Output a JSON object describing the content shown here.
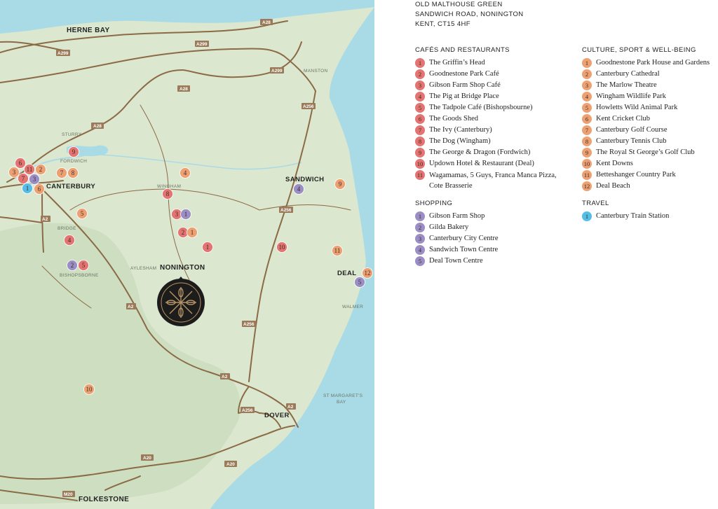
{
  "address": [
    "OLD MALTHOUSE GREEN",
    "SANDWICH ROAD, NONINGTON",
    "KENT, CT15 4HF"
  ],
  "colors": {
    "land": "#dbe7cf",
    "sea": "#a9dbe6",
    "road": "#8b6a46",
    "cafes": "#e37471",
    "culture": "#eda172",
    "shopping": "#9a8ec4",
    "travel": "#55bde6",
    "logo_bg": "#1c1c1c",
    "logo_fg": "#b59363"
  },
  "map": {
    "places": {
      "herne_bay": "HERNE BAY",
      "canterbury": "CANTERBURY",
      "sandwich": "SANDWICH",
      "nonington": "NONINGTON",
      "deal": "DEAL",
      "dover": "DOVER",
      "folkestone": "FOLKESTONE"
    },
    "small_places": {
      "sturry": "STURRY",
      "fordwich": "FORDWICH",
      "wingham": "WINGHAM",
      "manston": "MANSTON",
      "bridge": "BRIDGE",
      "bishopsborne": "BISHOPSBORNE",
      "aylesham": "AYLESHAM",
      "walmer": "WALMER",
      "st_margarets_1": "ST MARGARET'S",
      "st_margarets_2": "BAY"
    },
    "roads": {
      "a28_top": "A28",
      "a299_right": "A299",
      "a299_left": "A299",
      "a299_mid": "A299",
      "a28_mid": "A28",
      "a28_low": "A28",
      "a256_top": "A256",
      "a256_mid": "A256",
      "a256_low": "A256",
      "a256_dover": "A256",
      "a2_bridge": "A2",
      "a2_low": "A2",
      "a2_mid": "A2",
      "a2_dover": "A2",
      "a20_a": "A20",
      "a20_b": "A20",
      "m20": "M20"
    },
    "markers": [
      {
        "cat": "cafes",
        "n": "9"
      },
      {
        "cat": "cafes",
        "n": "6"
      },
      {
        "cat": "cafes",
        "n": "11"
      },
      {
        "cat": "culture",
        "n": "2"
      },
      {
        "cat": "culture",
        "n": "3"
      },
      {
        "cat": "cafes",
        "n": "7"
      },
      {
        "cat": "shopping",
        "n": "3"
      },
      {
        "cat": "travel",
        "n": "1"
      },
      {
        "cat": "culture",
        "n": "6"
      },
      {
        "cat": "culture",
        "n": "7"
      },
      {
        "cat": "culture",
        "n": "8"
      },
      {
        "cat": "culture",
        "n": "4"
      },
      {
        "cat": "cafes",
        "n": "8"
      },
      {
        "cat": "culture",
        "n": "5"
      },
      {
        "cat": "cafes",
        "n": "3"
      },
      {
        "cat": "shopping",
        "n": "1"
      },
      {
        "cat": "cafes",
        "n": "2"
      },
      {
        "cat": "culture",
        "n": "1"
      },
      {
        "cat": "cafes",
        "n": "1"
      },
      {
        "cat": "cafes",
        "n": "4"
      },
      {
        "cat": "shopping",
        "n": "2"
      },
      {
        "cat": "cafes",
        "n": "5"
      },
      {
        "cat": "shopping",
        "n": "4"
      },
      {
        "cat": "culture",
        "n": "9"
      },
      {
        "cat": "cafes",
        "n": "10"
      },
      {
        "cat": "culture",
        "n": "11"
      },
      {
        "cat": "culture",
        "n": "12"
      },
      {
        "cat": "shopping",
        "n": "5"
      },
      {
        "cat": "culture",
        "n": "10"
      }
    ]
  },
  "legend": {
    "cafes": {
      "title": "CAFÉS AND RESTAURANTS",
      "items": [
        {
          "n": "1",
          "label": "The Griffin’s Head"
        },
        {
          "n": "2",
          "label": "Goodnestone Park Café"
        },
        {
          "n": "3",
          "label": "Gibson Farm Shop Café"
        },
        {
          "n": "4",
          "label": "The Pig at Bridge Place"
        },
        {
          "n": "5",
          "label": "The Tadpole Café (Bishopsbourne)"
        },
        {
          "n": "6",
          "label": "The Goods Shed"
        },
        {
          "n": "7",
          "label": "The Ivy (Canterbury)"
        },
        {
          "n": "8",
          "label": "The Dog (Wingham)"
        },
        {
          "n": "9",
          "label": "The George & Dragon (Fordwich)"
        },
        {
          "n": "10",
          "label": "Updown Hotel & Restaurant (Deal)"
        },
        {
          "n": "11",
          "label": "Wagamamas, 5 Guys, Franca Manca Pizza, Cote Brasserie"
        }
      ]
    },
    "shopping": {
      "title": "SHOPPING",
      "items": [
        {
          "n": "1",
          "label": "Gibson Farm Shop"
        },
        {
          "n": "2",
          "label": "Gilda Bakery"
        },
        {
          "n": "3",
          "label": "Canterbury City Centre"
        },
        {
          "n": "4",
          "label": "Sandwich Town Centre"
        },
        {
          "n": "5",
          "label": "Deal Town Centre"
        }
      ]
    },
    "culture": {
      "title": "CULTURE, SPORT & WELL-BEING",
      "items": [
        {
          "n": "1",
          "label": "Goodnestone Park House and Gardens"
        },
        {
          "n": "2",
          "label": "Canterbury Cathedral"
        },
        {
          "n": "3",
          "label": "The Marlow Theatre"
        },
        {
          "n": "4",
          "label": "Wingham Wildlife Park"
        },
        {
          "n": "5",
          "label": "Howletts Wild Animal Park"
        },
        {
          "n": "6",
          "label": "Kent Cricket Club"
        },
        {
          "n": "7",
          "label": "Canterbury Golf Course"
        },
        {
          "n": "8",
          "label": "Canterbury Tennis Club"
        },
        {
          "n": "9",
          "label": "The Royal St George’s Golf Club"
        },
        {
          "n": "10",
          "label": "Kent Downs"
        },
        {
          "n": "11",
          "label": "Betteshanger Country Park"
        },
        {
          "n": "12",
          "label": "Deal Beach"
        }
      ]
    },
    "travel": {
      "title": "TRAVEL",
      "items": [
        {
          "n": "1",
          "label": "Canterbury Train Station"
        }
      ]
    }
  }
}
